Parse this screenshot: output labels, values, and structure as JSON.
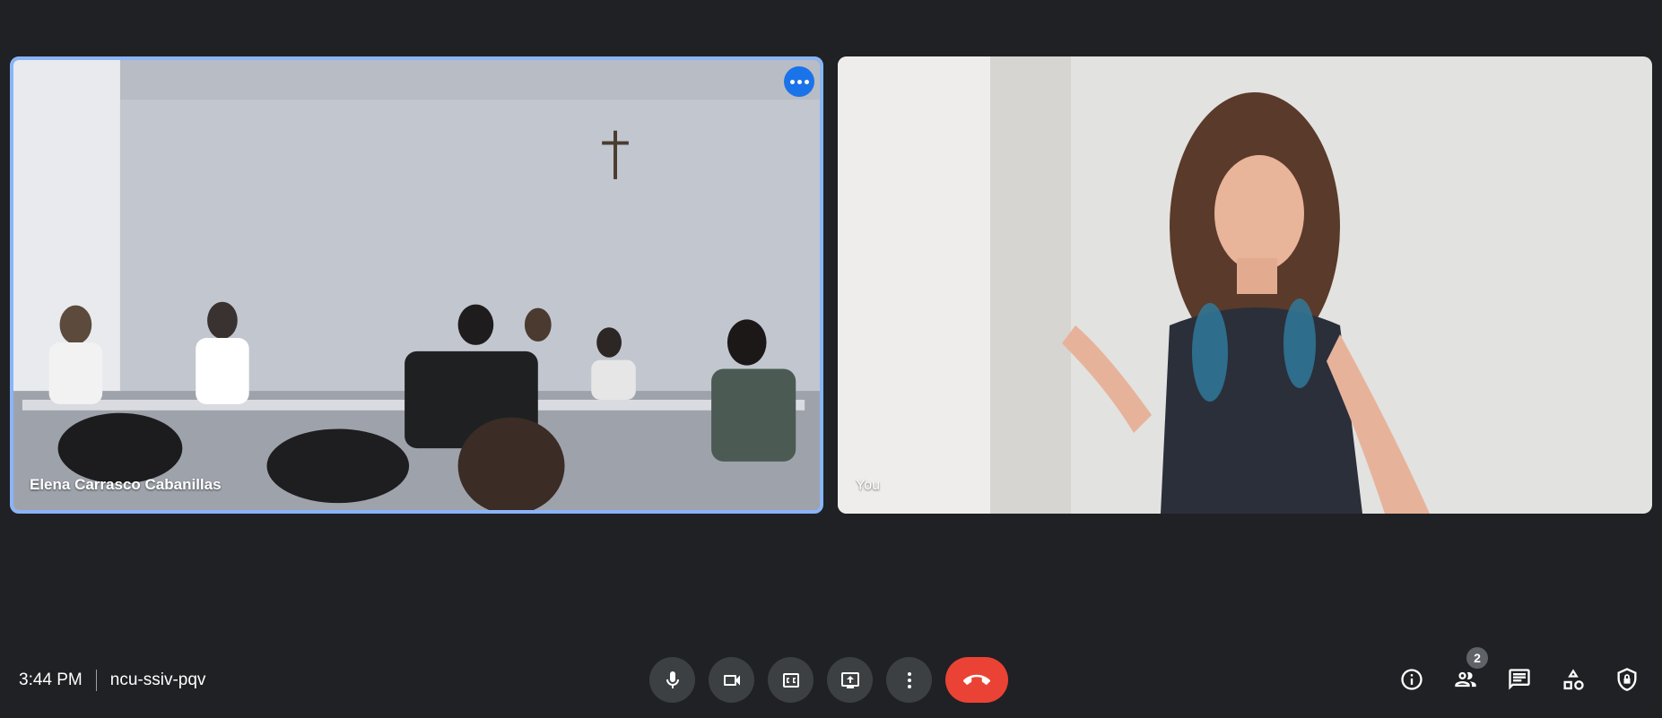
{
  "tiles": {
    "remote": {
      "name": "Elena Carrasco Cabanillas",
      "active_speaker": true
    },
    "self": {
      "name": "You"
    }
  },
  "meeting": {
    "time": "3:44 PM",
    "code": "ncu-ssiv-pqv"
  },
  "controls": [
    {
      "name": "microphone-button",
      "icon": "mic-icon"
    },
    {
      "name": "camera-button",
      "icon": "videocam-icon"
    },
    {
      "name": "captions-button",
      "icon": "closed-caption-icon"
    },
    {
      "name": "present-button",
      "icon": "present-screen-icon"
    },
    {
      "name": "more-options-button",
      "icon": "more-vert-icon"
    },
    {
      "name": "leave-call-button",
      "icon": "call-end-icon",
      "color": "#ea4335"
    }
  ],
  "side_controls": {
    "participants_count": "2"
  },
  "colors": {
    "background": "#202124",
    "button": "#3c4043",
    "active_border": "#8ab4f8",
    "accent": "#1a73e8",
    "end_call": "#ea4335"
  }
}
